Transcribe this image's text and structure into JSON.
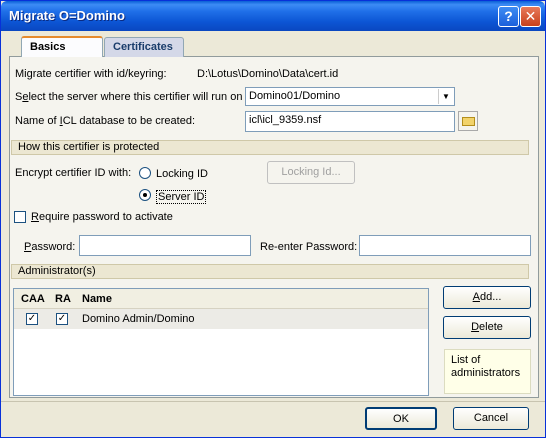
{
  "window": {
    "title": "Migrate O=Domino",
    "help_glyph": "?",
    "close_glyph": "✕"
  },
  "tabs": [
    {
      "label": "Basics"
    },
    {
      "label": "Certificates"
    }
  ],
  "basics": {
    "certifier_label": "Migrate certifier with id/keyring:",
    "certifier_path": "D:\\Lotus\\Domino\\Data\\cert.id",
    "server_label_pre": "S",
    "server_label_u": "e",
    "server_label_post": "lect the server where this certifier will run on :",
    "server_value": "Domino01/Domino",
    "icl_label_pre": "Name of ",
    "icl_label_u": "I",
    "icl_label_post": "CL database to be created:",
    "icl_value": "icl\\icl_9359.nsf"
  },
  "protection": {
    "section_title": "How this certifier is protected",
    "encrypt_label": "Encrypt certifier ID with:",
    "locking_id_label": "Locking ID",
    "server_id_label": "Server ID",
    "selected": "Server ID",
    "locking_id_button": "Locking Id...",
    "require_password_label_u": "R",
    "require_password_label_post": "equire password to activate",
    "password_label_u": "P",
    "password_label_post": "assword:",
    "password_value": "",
    "reenter_label": "Re-enter Password:",
    "reenter_value": ""
  },
  "admins": {
    "section_title": "Administrator(s)",
    "columns": [
      "CAA",
      "RA",
      "Name"
    ],
    "rows": [
      {
        "caa": "✓",
        "ra": "✓",
        "name": "Domino Admin/Domino"
      }
    ],
    "add_button_u": "A",
    "add_button_post": "dd...",
    "delete_button_u": "D",
    "delete_button_post": "elete",
    "info": "List of administrators"
  },
  "footer": {
    "ok_label": "OK",
    "cancel_label": "Cancel"
  }
}
